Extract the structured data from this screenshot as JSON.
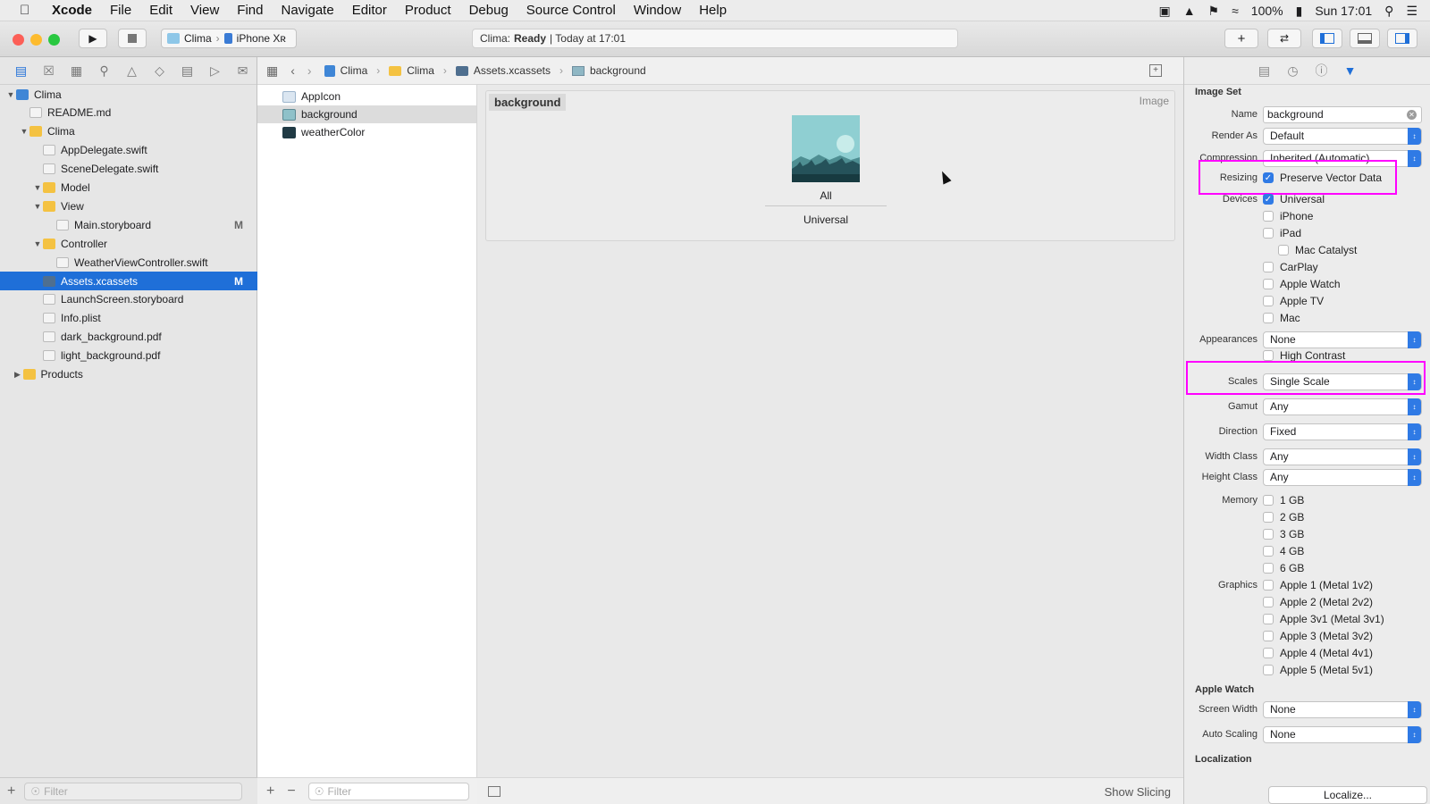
{
  "menubar": {
    "apple": "",
    "items": [
      "Xcode",
      "File",
      "Edit",
      "View",
      "Find",
      "Navigate",
      "Editor",
      "Product",
      "Debug",
      "Source Control",
      "Window",
      "Help"
    ],
    "battery": "100%",
    "clock": "Sun 17:01"
  },
  "toolbar": {
    "scheme_app": "Clima",
    "scheme_device": "iPhone Xʀ",
    "activity_app": "Clima:",
    "activity_status": "Ready",
    "activity_time": "| Today at 17:01"
  },
  "navigator": {
    "tree": [
      {
        "label": "Clima",
        "level": 0,
        "disclosure": "open",
        "icon": "project-icon"
      },
      {
        "label": "README.md",
        "level": 1,
        "icon": "file-icon"
      },
      {
        "label": "Clima",
        "level": 1,
        "disclosure": "open",
        "icon": "folder-icon"
      },
      {
        "label": "AppDelegate.swift",
        "level": 2,
        "icon": "swift-file-icon"
      },
      {
        "label": "SceneDelegate.swift",
        "level": 2,
        "icon": "swift-file-icon"
      },
      {
        "label": "Model",
        "level": 2,
        "disclosure": "open",
        "icon": "folder-icon"
      },
      {
        "label": "View",
        "level": 2,
        "disclosure": "open",
        "icon": "folder-icon"
      },
      {
        "label": "Main.storyboard",
        "level": 3,
        "icon": "storyboard-icon",
        "badge": "M"
      },
      {
        "label": "Controller",
        "level": 2,
        "disclosure": "open",
        "icon": "folder-icon"
      },
      {
        "label": "WeatherViewController.swift",
        "level": 3,
        "icon": "swift-file-icon"
      },
      {
        "label": "Assets.xcassets",
        "level": 2,
        "icon": "asset-catalog-icon",
        "badge": "M",
        "selected": true
      },
      {
        "label": "LaunchScreen.storyboard",
        "level": 2,
        "icon": "storyboard-icon"
      },
      {
        "label": "Info.plist",
        "level": 2,
        "icon": "plist-icon"
      },
      {
        "label": "dark_background.pdf",
        "level": 2,
        "icon": "pdf-icon"
      },
      {
        "label": "light_background.pdf",
        "level": 2,
        "icon": "pdf-icon"
      },
      {
        "label": "Products",
        "level": 0.5,
        "disclosure": "closed",
        "icon": "folder-icon"
      }
    ],
    "filter_placeholder": "Filter"
  },
  "jumpbar": {
    "crumbs": [
      "Clima",
      "Clima",
      "Assets.xcassets",
      "background"
    ]
  },
  "asset_list": {
    "items": [
      {
        "label": "AppIcon",
        "icon": "app-icon-set-icon"
      },
      {
        "label": "background",
        "icon": "image-set-icon",
        "selected": true
      },
      {
        "label": "weatherColor",
        "icon": "color-set-icon"
      }
    ],
    "filter_placeholder": "Filter"
  },
  "canvas": {
    "set_name": "background",
    "set_type": "Image",
    "slot_label": "All",
    "slot_group": "Universal",
    "show_slicing": "Show Slicing"
  },
  "inspector": {
    "section_image_set": "Image Set",
    "name_label": "Name",
    "name_value": "background",
    "render_as_label": "Render As",
    "render_as_value": "Default",
    "compression_label": "Compression",
    "compression_value": "Inherited (Automatic)",
    "resizing_label": "Resizing",
    "preserve_vector": "Preserve Vector Data",
    "devices_label": "Devices",
    "devices": [
      {
        "label": "Universal",
        "checked": true
      },
      {
        "label": "iPhone",
        "checked": false
      },
      {
        "label": "iPad",
        "checked": false
      },
      {
        "label": "Mac Catalyst",
        "checked": false,
        "indent": true
      },
      {
        "label": "CarPlay",
        "checked": false
      },
      {
        "label": "Apple Watch",
        "checked": false
      },
      {
        "label": "Apple TV",
        "checked": false
      },
      {
        "label": "Mac",
        "checked": false
      }
    ],
    "appearances_label": "Appearances",
    "appearances_value": "None",
    "high_contrast": "High Contrast",
    "scales_label": "Scales",
    "scales_value": "Single Scale",
    "gamut_label": "Gamut",
    "gamut_value": "Any",
    "direction_label": "Direction",
    "direction_value": "Fixed",
    "width_class_label": "Width Class",
    "width_class_value": "Any",
    "height_class_label": "Height Class",
    "height_class_value": "Any",
    "memory_label": "Memory",
    "memory": [
      "1 GB",
      "2 GB",
      "3 GB",
      "4 GB",
      "6 GB"
    ],
    "graphics_label": "Graphics",
    "graphics": [
      "Apple 1 (Metal 1v2)",
      "Apple 2 (Metal 2v2)",
      "Apple 3v1 (Metal 3v1)",
      "Apple 3 (Metal 3v2)",
      "Apple 4 (Metal 4v1)",
      "Apple 5 (Metal 5v1)"
    ],
    "section_apple_watch": "Apple Watch",
    "screen_width_label": "Screen Width",
    "screen_width_value": "None",
    "auto_scaling_label": "Auto Scaling",
    "auto_scaling_value": "None",
    "section_localization": "Localization",
    "localize_button": "Localize..."
  },
  "colors": {
    "accent": "#2f7ae5",
    "selection": "#1f6fd8",
    "annotation": "#ff00ff"
  }
}
